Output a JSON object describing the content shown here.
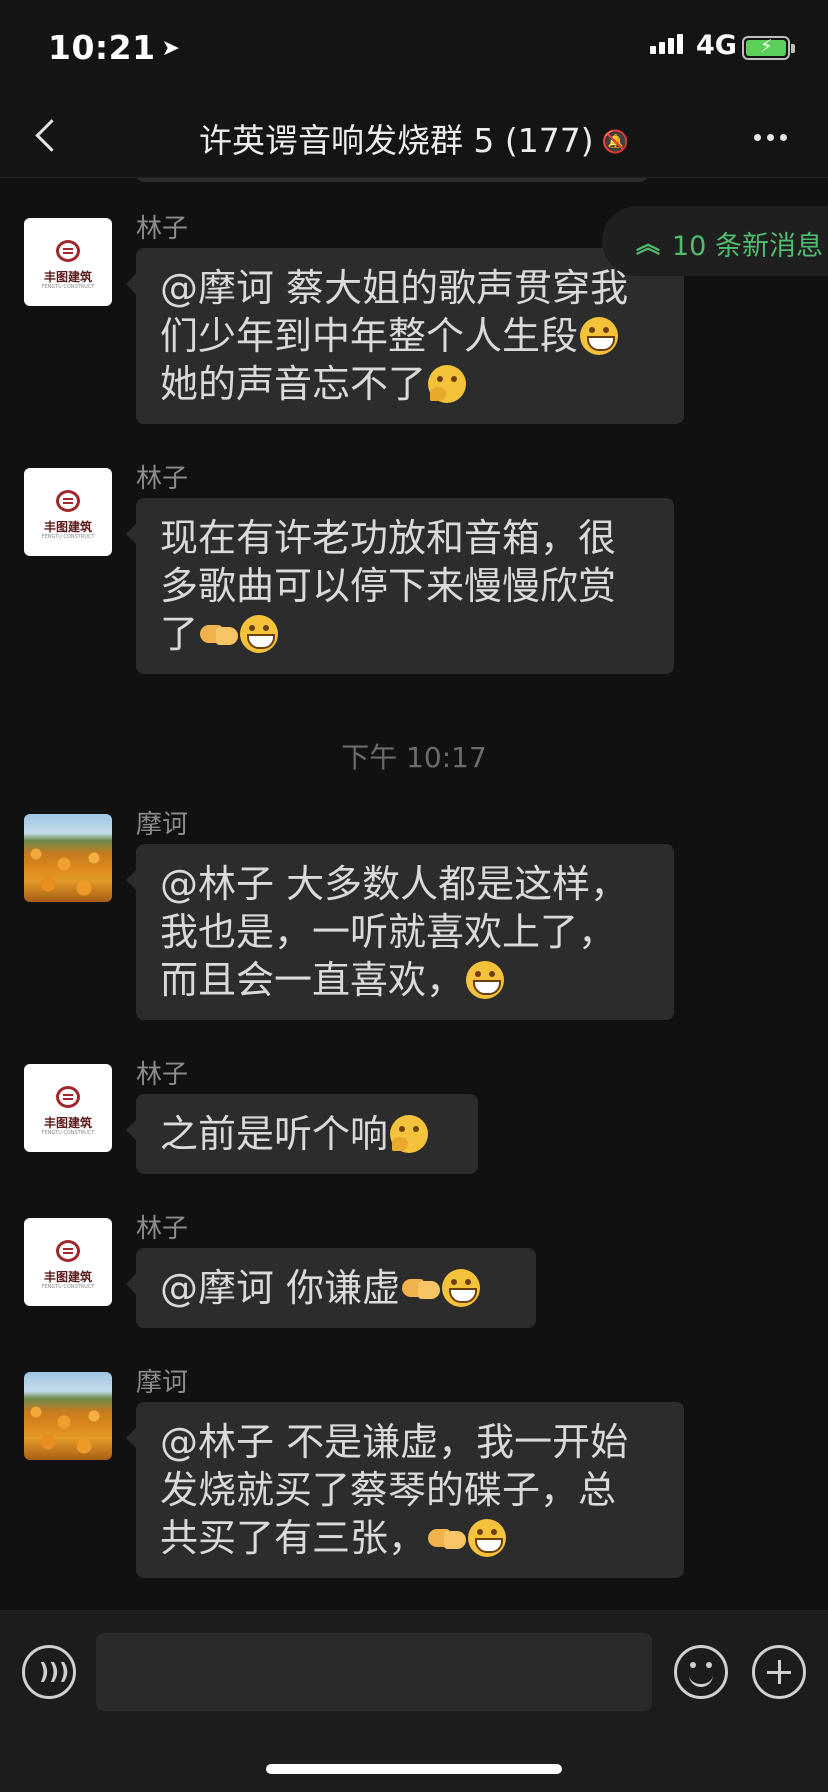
{
  "status_bar": {
    "time": "10:21",
    "location_icon": "location-arrow-icon",
    "network": "4G",
    "battery_color": "#5ad05a"
  },
  "header": {
    "title": "许英谔音响发烧群 5 (177)",
    "mute_icon": "bell-slash-icon",
    "back_icon": "chevron-left-icon",
    "more_icon": "more-dots-icon"
  },
  "new_messages": {
    "label": "10 条新消息",
    "icon": "double-chevron-up-icon",
    "color": "#4fbd6d"
  },
  "messages": [
    {
      "sender": "林子",
      "avatar": "company-logo",
      "logo_text": "丰图建筑",
      "logo_sub": "FENGTU CONSTRUCT",
      "lines": [
        "@摩诃 蔡大姐的歌声贯穿我",
        "们少年到中年整个人生段",
        "她的声音忘不了"
      ],
      "emoji": [
        "grinning-face",
        "thinking-face"
      ]
    },
    {
      "sender": "林子",
      "avatar": "company-logo",
      "logo_text": "丰图建筑",
      "logo_sub": "FENGTU CONSTRUCT",
      "lines": [
        "现在有许老功放和音箱，很",
        "多歌曲可以停下来慢慢欣赏",
        "了"
      ],
      "emoji": [
        "handshake",
        "grinning-face"
      ]
    },
    {
      "sender": "摩诃",
      "avatar": "flower-field-photo",
      "lines": [
        "@林子 大多数人都是这样，",
        "我也是，一听就喜欢上了，",
        "而且会一直喜欢，"
      ],
      "emoji": [
        "grinning-face"
      ]
    },
    {
      "sender": "林子",
      "avatar": "company-logo",
      "logo_text": "丰图建筑",
      "logo_sub": "FENGTU CONSTRUCT",
      "lines": [
        "之前是听个响"
      ],
      "emoji": [
        "thinking-face"
      ]
    },
    {
      "sender": "林子",
      "avatar": "company-logo",
      "logo_text": "丰图建筑",
      "logo_sub": "FENGTU CONSTRUCT",
      "lines": [
        "@摩诃 你谦虚"
      ],
      "emoji": [
        "handshake",
        "grinning-face"
      ]
    },
    {
      "sender": "摩诃",
      "avatar": "flower-field-photo",
      "lines": [
        "@林子 不是谦虚，我一开始",
        "发烧就买了蔡琴的碟子，总",
        "共买了有三张，"
      ],
      "emoji": [
        "handshake",
        "grinning-face"
      ]
    }
  ],
  "timestamp": "下午 10:17",
  "input_bar": {
    "voice_icon": "voice-icon",
    "emoji_icon": "smiley-icon",
    "plus_icon": "plus-circle-icon",
    "placeholder": ""
  }
}
